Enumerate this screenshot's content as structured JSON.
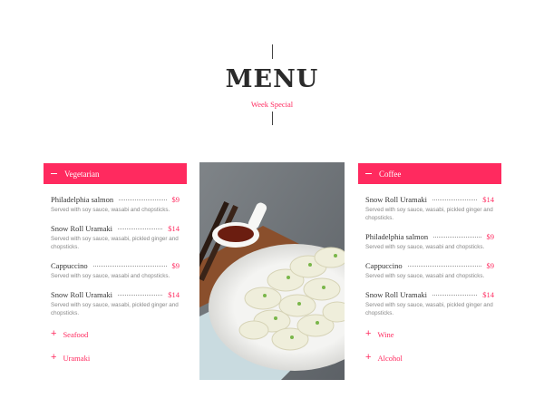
{
  "header": {
    "title": "MENU",
    "subtitle": "Week Special"
  },
  "colors": {
    "accent": "#ff2a5f"
  },
  "left_column": {
    "category": "Vegetarian",
    "items": [
      {
        "name": "Philadelphia salmon",
        "price": "$9",
        "description": "Served with soy sauce, wasabi and chopsticks."
      },
      {
        "name": "Snow Roll Uramaki",
        "price": "$14",
        "description": "Served with soy sauce, wasabi, pickled ginger and chopsticks."
      },
      {
        "name": "Cappuccino",
        "price": "$9",
        "description": "Served with soy sauce, wasabi and chopsticks."
      },
      {
        "name": "Snow Roll Uramaki",
        "price": "$14",
        "description": "Served with soy sauce, wasabi, pickled ginger and chopsticks."
      }
    ],
    "collapsed": [
      "Seafood",
      "Uramaki"
    ]
  },
  "right_column": {
    "category": "Coffee",
    "items": [
      {
        "name": "Snow Roll Uramaki",
        "price": "$14",
        "description": "Served with soy sauce, wasabi, pickled ginger and chopsticks."
      },
      {
        "name": "Philadelphia salmon",
        "price": "$9",
        "description": "Served with soy sauce, wasabi and chopsticks."
      },
      {
        "name": "Cappuccino",
        "price": "$9",
        "description": "Served with soy sauce, wasabi and chopsticks."
      },
      {
        "name": "Snow Roll Uramaki",
        "price": "$14",
        "description": "Served with soy sauce, wasabi, pickled ginger and chopsticks."
      }
    ],
    "collapsed": [
      "Wine",
      "Alcohol"
    ]
  },
  "icons": {
    "expanded": "minus-icon",
    "collapsed": "plus-icon"
  }
}
